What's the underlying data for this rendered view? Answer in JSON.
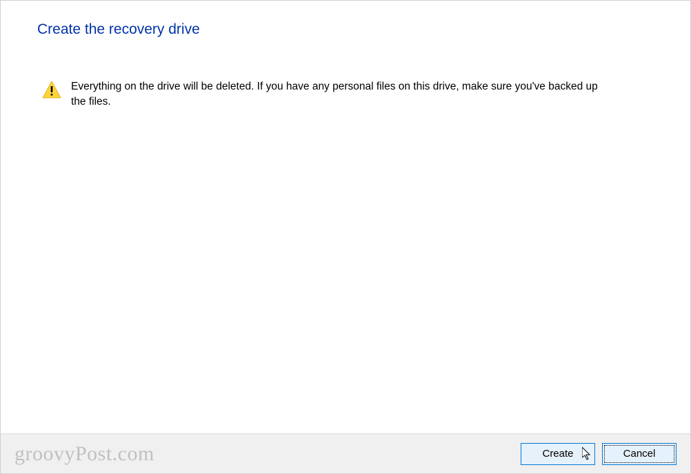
{
  "dialog": {
    "title": "Create the recovery drive",
    "warning_message": "Everything on the drive will be deleted. If you have any personal files on this drive, make sure you've backed up the files."
  },
  "buttons": {
    "create_label": "Create",
    "cancel_label": "Cancel"
  },
  "watermark": "groovyPost.com"
}
